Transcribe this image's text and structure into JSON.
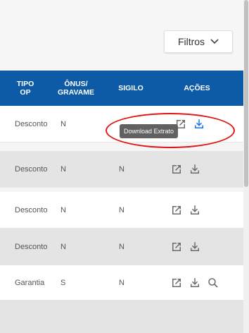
{
  "toolbar": {
    "filters_label": "Filtros"
  },
  "table": {
    "headers": {
      "tipo": "TIPO\nOP",
      "onus": "ÔNUS/\nGRAVAME",
      "sigilo": "SIGILO",
      "acoes": "AÇÕES"
    },
    "rows": [
      {
        "tipo": "Desconto",
        "onus": "N",
        "sigilo": ""
      },
      {
        "tipo": "Desconto",
        "onus": "N",
        "sigilo": "N"
      },
      {
        "tipo": "Desconto",
        "onus": "N",
        "sigilo": "N"
      },
      {
        "tipo": "Desconto",
        "onus": "N",
        "sigilo": "N"
      },
      {
        "tipo": "Garantia",
        "onus": "S",
        "sigilo": "N"
      }
    ]
  },
  "tooltip": {
    "text": "Download Extrato"
  },
  "colors": {
    "header_bg": "#0d5aa7",
    "row_alt": "#e4e4e4",
    "icon": "#6b6b6b",
    "download_icon_active": "#1a73e8",
    "annotation": "#e01515"
  },
  "icons": {
    "open": "open-external-icon",
    "download": "download-icon",
    "search": "search-icon",
    "chevron": "chevron-down-icon"
  }
}
